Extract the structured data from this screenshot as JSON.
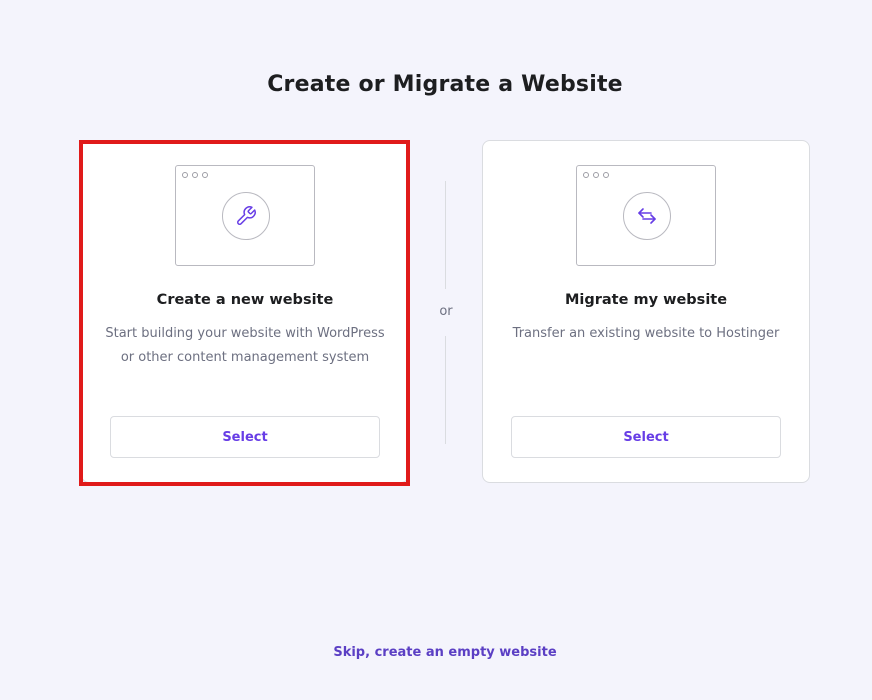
{
  "page": {
    "title": "Create or Migrate a Website",
    "divider_text": "or",
    "skip_link": "Skip, create an empty website"
  },
  "cards": [
    {
      "title": "Create a new website",
      "description": "Start building your website with WordPress or other content management system",
      "button_label": "Select",
      "icon": "wrench-icon",
      "highlighted": true
    },
    {
      "title": "Migrate my website",
      "description": "Transfer an existing website to Hostinger",
      "button_label": "Select",
      "icon": "transfer-arrows-icon",
      "highlighted": false
    }
  ],
  "colors": {
    "background": "#f4f4fc",
    "accent": "#673de6",
    "highlight": "#e01a1a",
    "title": "#1d1e20",
    "muted_text": "#6d7081"
  }
}
